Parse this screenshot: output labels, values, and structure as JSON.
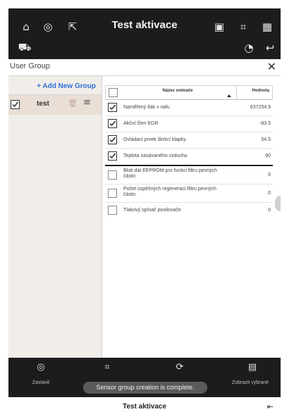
{
  "topbar": {
    "title": "Test aktivace",
    "icons": [
      "home-icon",
      "vehicle-diagnostic-icon",
      "export-icon",
      "camera-icon",
      "focus-icon",
      "grid-icon",
      "car-icon",
      "speedometer-icon",
      "return-icon"
    ]
  },
  "user_group": {
    "label": "User Group",
    "add_label": "+ Add New Group",
    "groups": [
      {
        "name": "test",
        "checked": true
      }
    ]
  },
  "table": {
    "header_name": "Název snímače",
    "header_value": "Hodnota",
    "selected_rows": [
      {
        "name": "Naměřený tlak v railu",
        "value": "637254.9",
        "checked": true
      },
      {
        "name": "Akční člen EGR",
        "value": "-83.5",
        "checked": true
      },
      {
        "name": "Ovládací prvek škrticí klapky",
        "value": "54.5",
        "checked": true
      },
      {
        "name": "Teplota nasávaného vzduchu",
        "value": "90",
        "checked": true
      }
    ],
    "other_rows": [
      {
        "name": "Blok dat EEPROM pro funkci filtru pevných částic",
        "value": "0",
        "checked": false
      },
      {
        "name": "Počet úspěšných regenerací filtru pevných částic",
        "value": "0",
        "checked": false
      },
      {
        "name": "Tlakový spínač posilovače",
        "value": "0",
        "checked": false
      }
    ]
  },
  "bottombar": {
    "stop_label": "Zastavit",
    "show_selected_label": "Zobrazit vybrané",
    "toast": "Sensor group creation is complete."
  },
  "footer": {
    "title": "Test aktivace"
  }
}
